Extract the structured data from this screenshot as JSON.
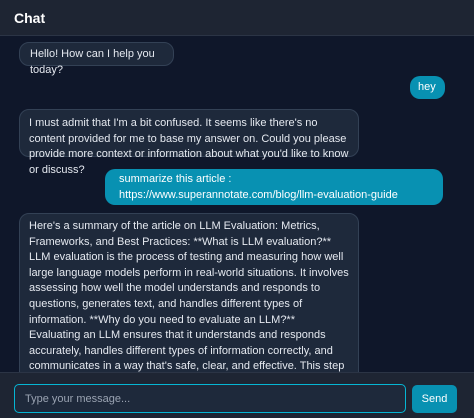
{
  "header": {
    "title": "Chat"
  },
  "messages": [
    {
      "role": "bot",
      "text": "Hello! How can I help you today?"
    },
    {
      "role": "user",
      "text": "hey"
    },
    {
      "role": "bot",
      "text": "I must admit that I'm a bit confused. It seems like there's no content provided for me to base my answer on. Could you please provide more context or information about what you'd like to know or discuss?"
    },
    {
      "role": "user",
      "text": "summarize this article : https://www.superannotate.com/blog/llm-evaluation-guide"
    },
    {
      "role": "bot",
      "text": "Here's a summary of the article on LLM Evaluation: Metrics, Frameworks, and Best Practices: **What is LLM evaluation?** LLM evaluation is the process of testing and measuring how well large language models perform in real-world situations. It involves assessing how well the model understands and responds to questions, generates text, and handles different types of information. **Why do you need to evaluate an LLM?** Evaluating an LLM ensures that it understands and responds accurately, handles different types of information correctly, and communicates in a way that's safe, clear, and effective. This step is essential because it allows us to fine-tune the model based on real feedback, improving its performance and reliability. **LLM model evals vs. LLM system evals** There's a difference between looking at a"
    }
  ],
  "composer": {
    "placeholder": "Type your message...",
    "value": "",
    "send_label": "Send"
  },
  "colors": {
    "accent": "#0891b2",
    "background": "#0f172a",
    "bubble_bot": "#1e293b"
  }
}
